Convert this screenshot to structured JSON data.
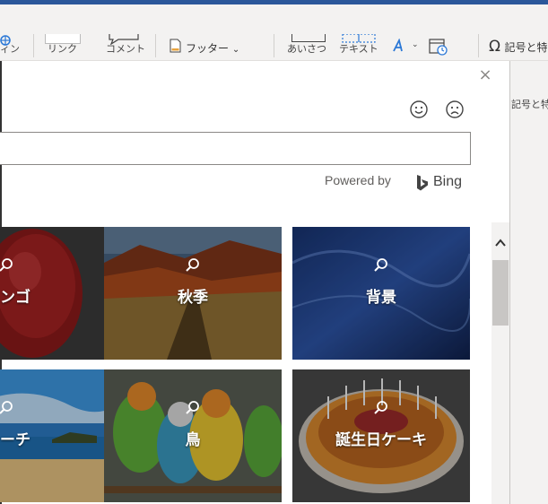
{
  "ribbon": {
    "partial_left1": "ィン",
    "link_label": "リンク",
    "comment_label": "コメント",
    "footer_label": "フッター",
    "footer_chevron": "⌄",
    "greeting_label": "あいさつ",
    "textbox_label": "テキスト",
    "symbol_label": "記号と特"
  },
  "sidepanel": {
    "label": "記号と特"
  },
  "dialog": {
    "close_icon": "close-icon",
    "search": {
      "value": "",
      "placeholder": ""
    },
    "powered_by": "Powered by",
    "bing": "Bing",
    "tiles": [
      {
        "label": "リンゴ",
        "display": "ンゴ"
      },
      {
        "label": "秋季",
        "display": "秋季"
      },
      {
        "label": "背景",
        "display": "背景"
      },
      {
        "label": "ビーチ",
        "display": "ーチ"
      },
      {
        "label": "鳥",
        "display": "鳥"
      },
      {
        "label": "誕生日ケーキ",
        "display": "誕生日ケーキ"
      }
    ]
  },
  "colors": {
    "title_bar": "#2b579a",
    "tile_overlay": "rgba(0,0,0,0.35)"
  }
}
